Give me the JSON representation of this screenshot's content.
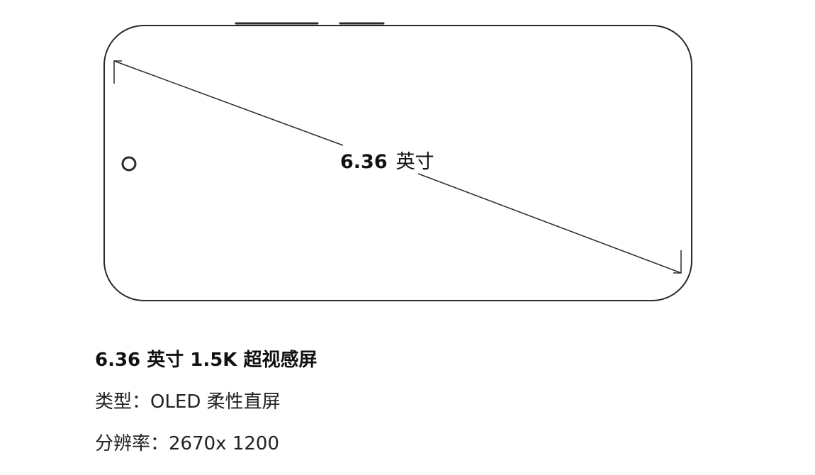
{
  "diagram": {
    "size_number": "6.36",
    "size_unit": "英寸",
    "stroke_color": "#2a2a2a"
  },
  "specs": {
    "title": "6.36 英寸 1.5K 超视感屏",
    "type_line": "类型：OLED 柔性直屏",
    "resolution_line": "分辨率：2670x 1200"
  }
}
